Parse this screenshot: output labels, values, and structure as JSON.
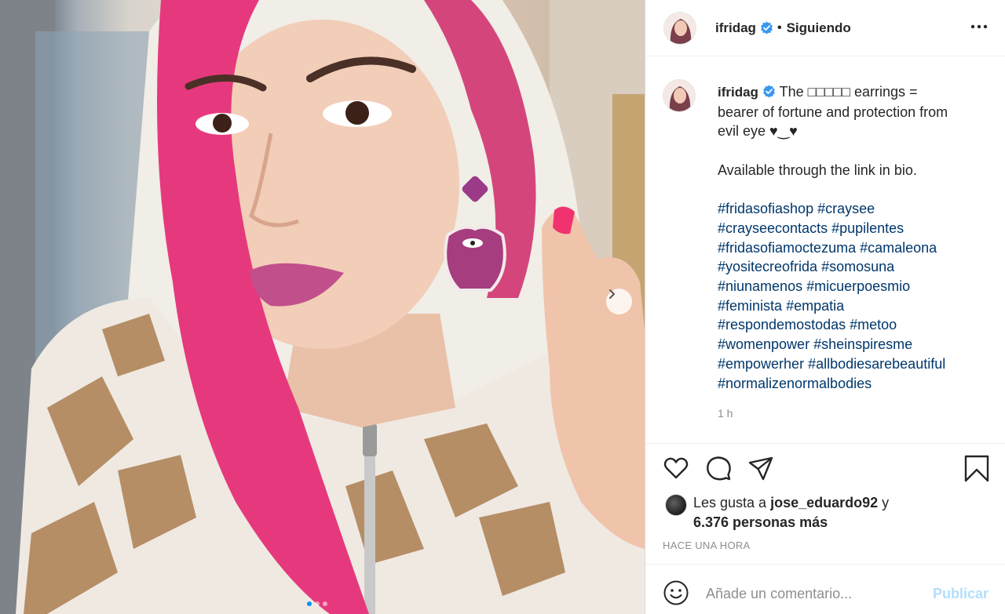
{
  "post": {
    "username": "ifridag",
    "follow_status": "Siguiendo",
    "separator": "•",
    "caption": {
      "lines": [
        "The □□□□□ earrings =",
        "bearer of fortune and protection from",
        "evil eye ♥‿♥",
        "",
        "Available through the link in bio."
      ],
      "hashtag_lines": [
        [
          "#fridasofiashop",
          "#craysee"
        ],
        [
          "#crayseecontacts",
          "#pupilentes"
        ],
        [
          "#fridasofiamoctezuma",
          "#camaleona"
        ],
        [
          "#yositecreofrida",
          "#somosuna"
        ],
        [
          "#niunamenos",
          "#micuerpoesmio"
        ],
        [
          "#feminista",
          "#empatia"
        ],
        [
          "#respondemostodas",
          "#metoo"
        ],
        [
          "#womenpower",
          "#sheinspiresme"
        ],
        [
          "#empowerher",
          "#allbodiesarebeautiful"
        ],
        [
          "#normalizenormalbodies"
        ]
      ],
      "age": "1 h"
    },
    "likes": {
      "prefix": "Les gusta a",
      "user": "jose_eduardo92",
      "conjunction": "y",
      "others": "6.376 personas más"
    },
    "posted_ago": "HACE UNA HORA",
    "comment": {
      "placeholder": "Añade un comentario...",
      "publish_label": "Publicar"
    },
    "carousel": {
      "slide_count": 3,
      "active_slide": 1
    }
  },
  "colors": {
    "accent": "#0095f6",
    "hashtag": "#00376b",
    "publish_disabled": "#b2dffc",
    "muted": "#8e8e8e",
    "verified": "#3897f0"
  },
  "icons": {
    "verified": "verified-badge-icon",
    "more": "more-options-icon",
    "like": "heart-icon",
    "comment": "comment-bubble-icon",
    "share": "paper-plane-icon",
    "save": "bookmark-icon",
    "emoji": "smiley-icon",
    "next": "chevron-right-icon"
  }
}
